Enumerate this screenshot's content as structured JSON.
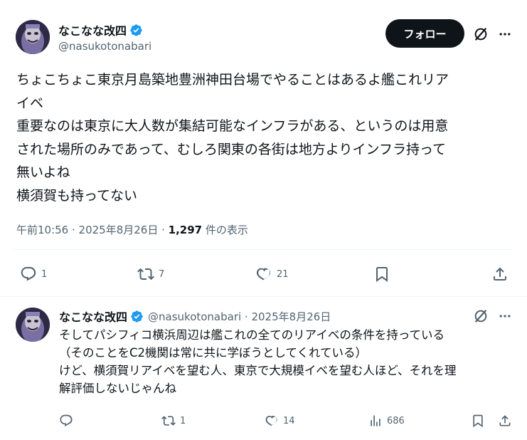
{
  "tweet": {
    "author_name": "なこなな改四",
    "author_handle": "@nasukotonabari",
    "follow_label": "フォロー",
    "text_lines": [
      "ちょこちょこ東京月島築地豊洲神田台場でやることはあるよ艦これリア",
      "イベ",
      "重要なのは東京に大人数が集結可能なインフラがある、というのは用意",
      "された場所のみであって、むしろ関東の各街は地方よりインフラ持って",
      "無いよね",
      "横須賀も持ってない"
    ],
    "timestamp": "午前10:56 · 2025年8月26日 · ",
    "views_count": "1,297",
    "views_label": " 件の表示",
    "stats": {
      "replies": "1",
      "reposts": "7",
      "likes": "21"
    }
  },
  "reply": {
    "author_name": "なこなな改四",
    "author_handle_date": "@nasukotonabari · 2025年8月26日",
    "text_lines": [
      "そしてパシフィコ横浜周辺は艦これの全てのリアイベの条件を持っている",
      "（そのことをC2機関は常に共に学ぼうとしてくれている）",
      "けど、横須賀リアイベを望む人、東京で大規模イベを望む人ほど、それを理",
      "解評価しないじゃんね"
    ],
    "stats": {
      "replies": "",
      "reposts": "1",
      "likes": "14",
      "views": "686"
    }
  },
  "colors": {
    "verified": "#1d9bf0",
    "text_primary": "#0f1419",
    "text_secondary": "#536471",
    "divider": "#eff3f4"
  },
  "icons": [
    "verified-badge-icon",
    "grok-icon",
    "more-icon",
    "reply-icon",
    "repost-icon",
    "like-icon",
    "bookmark-icon",
    "share-icon",
    "views-icon"
  ]
}
